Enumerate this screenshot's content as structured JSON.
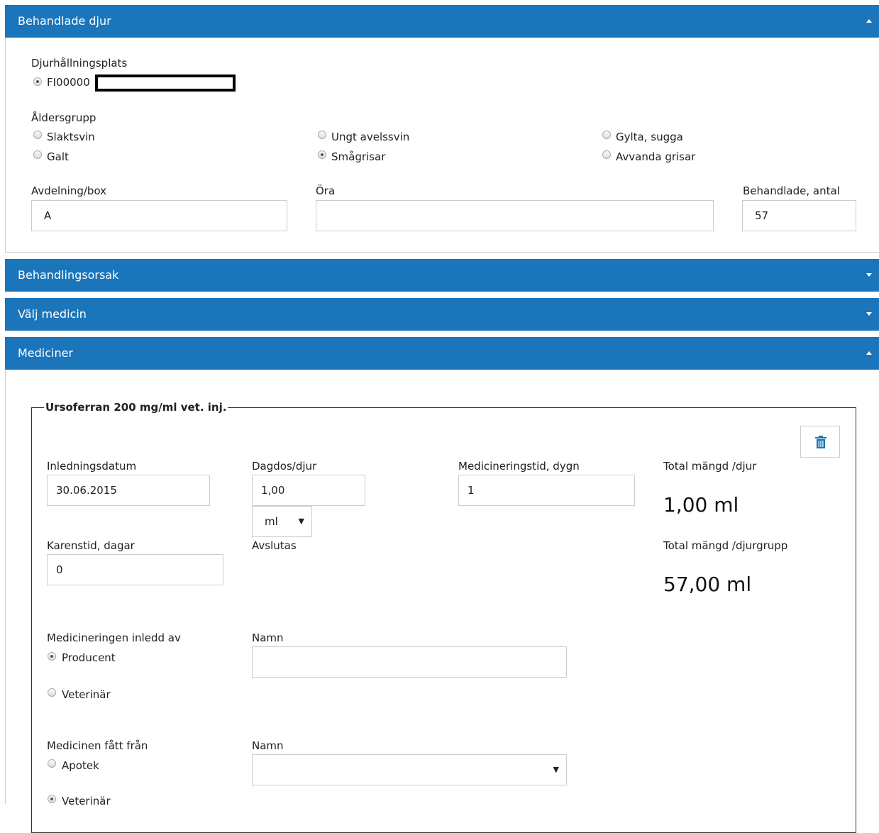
{
  "panels": {
    "animals": {
      "title": "Behandlade djur"
    },
    "reason": {
      "title": "Behandlingsorsak"
    },
    "choose_medicine": {
      "title": "Välj medicin"
    },
    "medicines": {
      "title": "Mediciner"
    }
  },
  "animals": {
    "location_label": "Djurhållningsplats",
    "location_value": "FI00000",
    "age_group_label": "Åldersgrupp",
    "age_groups": [
      "Slaktsvin",
      "Ungt avelssvin",
      "Gylta, sugga",
      "Galt",
      "Smågrisar",
      "Avvanda grisar"
    ],
    "selected_age_group": "Smågrisar",
    "section_label": "Avdelning/box",
    "section_value": "A",
    "ear_label": "Öra",
    "ear_value": "",
    "count_label": "Behandlade, antal",
    "count_value": "57"
  },
  "medicine": {
    "name": "Ursoferran 200 mg/ml vet. inj.",
    "start_date_label": "Inledningsdatum",
    "start_date_value": "30.06.2015",
    "daily_dose_label": "Dagdos/djur",
    "daily_dose_value": "1,00",
    "unit_value": "ml",
    "duration_label": "Medicineringstid, dygn",
    "duration_value": "1",
    "total_per_animal_label": "Total mängd /djur",
    "total_per_animal_value": "1,00 ml",
    "withdrawal_label": "Karenstid, dagar",
    "withdrawal_value": "0",
    "ends_label": "Avslutas",
    "total_per_group_label": "Total mängd /djurgrupp",
    "total_per_group_value": "57,00 ml",
    "initiated_by_label": "Medicineringen inledd av",
    "initiated_by_options": [
      "Producent",
      "Veterinär"
    ],
    "initiated_name_label": "Namn",
    "initiated_name_value": "",
    "obtained_from_label": "Medicinen fått från",
    "obtained_from_options": [
      "Apotek",
      "Veterinär"
    ],
    "obtained_name_label": "Namn",
    "obtained_name_value": ""
  },
  "colors": {
    "header": "#1b75bb"
  },
  "icons": {
    "delete": "trash-icon"
  }
}
